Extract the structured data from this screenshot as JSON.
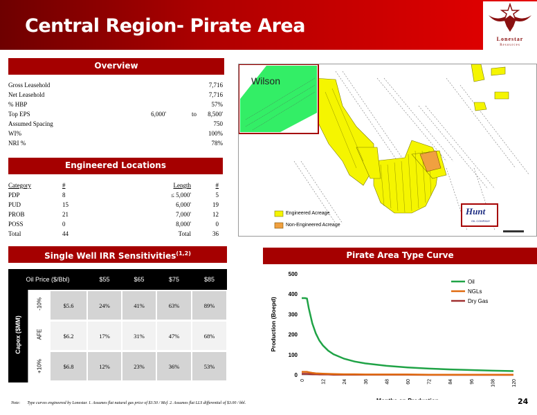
{
  "header": {
    "title": "Central Region- Pirate Area",
    "logo_name": "Lonestar",
    "logo_sub": "Resources"
  },
  "overview": {
    "heading": "Overview",
    "rows": [
      {
        "label": "Gross Leasehold",
        "value": "7,716"
      },
      {
        "label": "Net Leasehold",
        "value": "7,716"
      },
      {
        "label": "% HBP",
        "value": "57%"
      },
      {
        "label": "Top EPS",
        "from": "6,000'",
        "to_word": "to",
        "value": "8,500'"
      },
      {
        "label": "Assumed Spacing",
        "value": "750"
      },
      {
        "label": "WI%",
        "value": "100%"
      },
      {
        "label": "NRI %",
        "value": "78%"
      }
    ]
  },
  "engineered": {
    "heading": "Engineered Locations",
    "columns": [
      "Category",
      "#",
      "Length",
      "#"
    ],
    "rows": [
      {
        "cat": "PDP",
        "n": "8",
        "len": "≤ 5,000'",
        "n2": "5"
      },
      {
        "cat": "PUD",
        "n": "15",
        "len": "6,000'",
        "n2": "19"
      },
      {
        "cat": "PROB",
        "n": "21",
        "len": "7,000'",
        "n2": "12"
      },
      {
        "cat": "POSS",
        "n": "0",
        "len": "8,000'",
        "n2": "0"
      },
      {
        "cat": "Total",
        "n": "44",
        "len": "Total",
        "n2": "36"
      }
    ]
  },
  "irr": {
    "heading": "Single Well IRR Sensitivities",
    "heading_sup": "(1,2)",
    "oil_price_label": "Oil Price ($/Bbl)",
    "prices": [
      "$55",
      "$65",
      "$75",
      "$85"
    ],
    "capex_label": "Capex ($MM)",
    "rows": [
      {
        "afe": "-10%",
        "capex": "$5.6",
        "values": [
          "24%",
          "41%",
          "63%",
          "89%"
        ]
      },
      {
        "afe": "AFE",
        "capex": "$6.2",
        "values": [
          "17%",
          "31%",
          "47%",
          "68%"
        ]
      },
      {
        "afe": "+10%",
        "capex": "$6.8",
        "values": [
          "12%",
          "23%",
          "36%",
          "53%"
        ]
      }
    ]
  },
  "map": {
    "inset_label": "Wilson",
    "legend": [
      "Engineered Acreage",
      "Non-Engineered Acreage"
    ],
    "company_logo": "Hunt",
    "company_sub": "OIL COMPANY",
    "colors": {
      "engineered": "#f5f500",
      "non_engineered": "#f0a040",
      "inset": "#33ee66"
    }
  },
  "type_curve": {
    "heading": "Pirate Area Type Curve"
  },
  "chart_data": {
    "type": "line",
    "title": "",
    "xlabel": "Months on Production",
    "ylabel": "Production (Boepd)",
    "xlim": [
      0,
      120
    ],
    "ylim": [
      0,
      500
    ],
    "x_ticks": [
      "0",
      "12",
      "24",
      "36",
      "48",
      "60",
      "72",
      "84",
      "96",
      "108",
      "120"
    ],
    "y_ticks": [
      "0",
      "100",
      "200",
      "300",
      "400",
      "500"
    ],
    "legend_position": "top-right",
    "x": [
      0,
      2,
      3,
      4,
      6,
      8,
      10,
      12,
      15,
      18,
      24,
      30,
      36,
      48,
      60,
      72,
      84,
      96,
      108,
      120
    ],
    "series": [
      {
        "name": "Oil",
        "color": "#1fa346",
        "values": [
          380,
          380,
          378,
          330,
          255,
          205,
          170,
          146,
          120,
          102,
          80,
          66,
          57,
          45,
          37,
          31,
          27,
          24,
          21,
          19
        ]
      },
      {
        "name": "NGLs",
        "color": "#e06a10",
        "values": [
          15,
          15,
          15,
          13,
          10,
          8,
          7,
          6,
          5,
          4,
          3,
          3,
          2,
          2,
          2,
          1,
          1,
          1,
          1,
          1
        ]
      },
      {
        "name": "Dry Gas",
        "color": "#a03030",
        "values": [
          5,
          5,
          5,
          4,
          3,
          3,
          2,
          2,
          2,
          1,
          1,
          1,
          1,
          1,
          1,
          0,
          0,
          0,
          0,
          0
        ]
      }
    ]
  },
  "footer": {
    "note_label": "Note:",
    "note_text": "Type curves engineered by Lonestar. 1. Assumes flat natural gas price of $3.50 / Mcf. 2. Assumes flat LLS differential of $3.00 / bbl.",
    "page_number": "24"
  }
}
